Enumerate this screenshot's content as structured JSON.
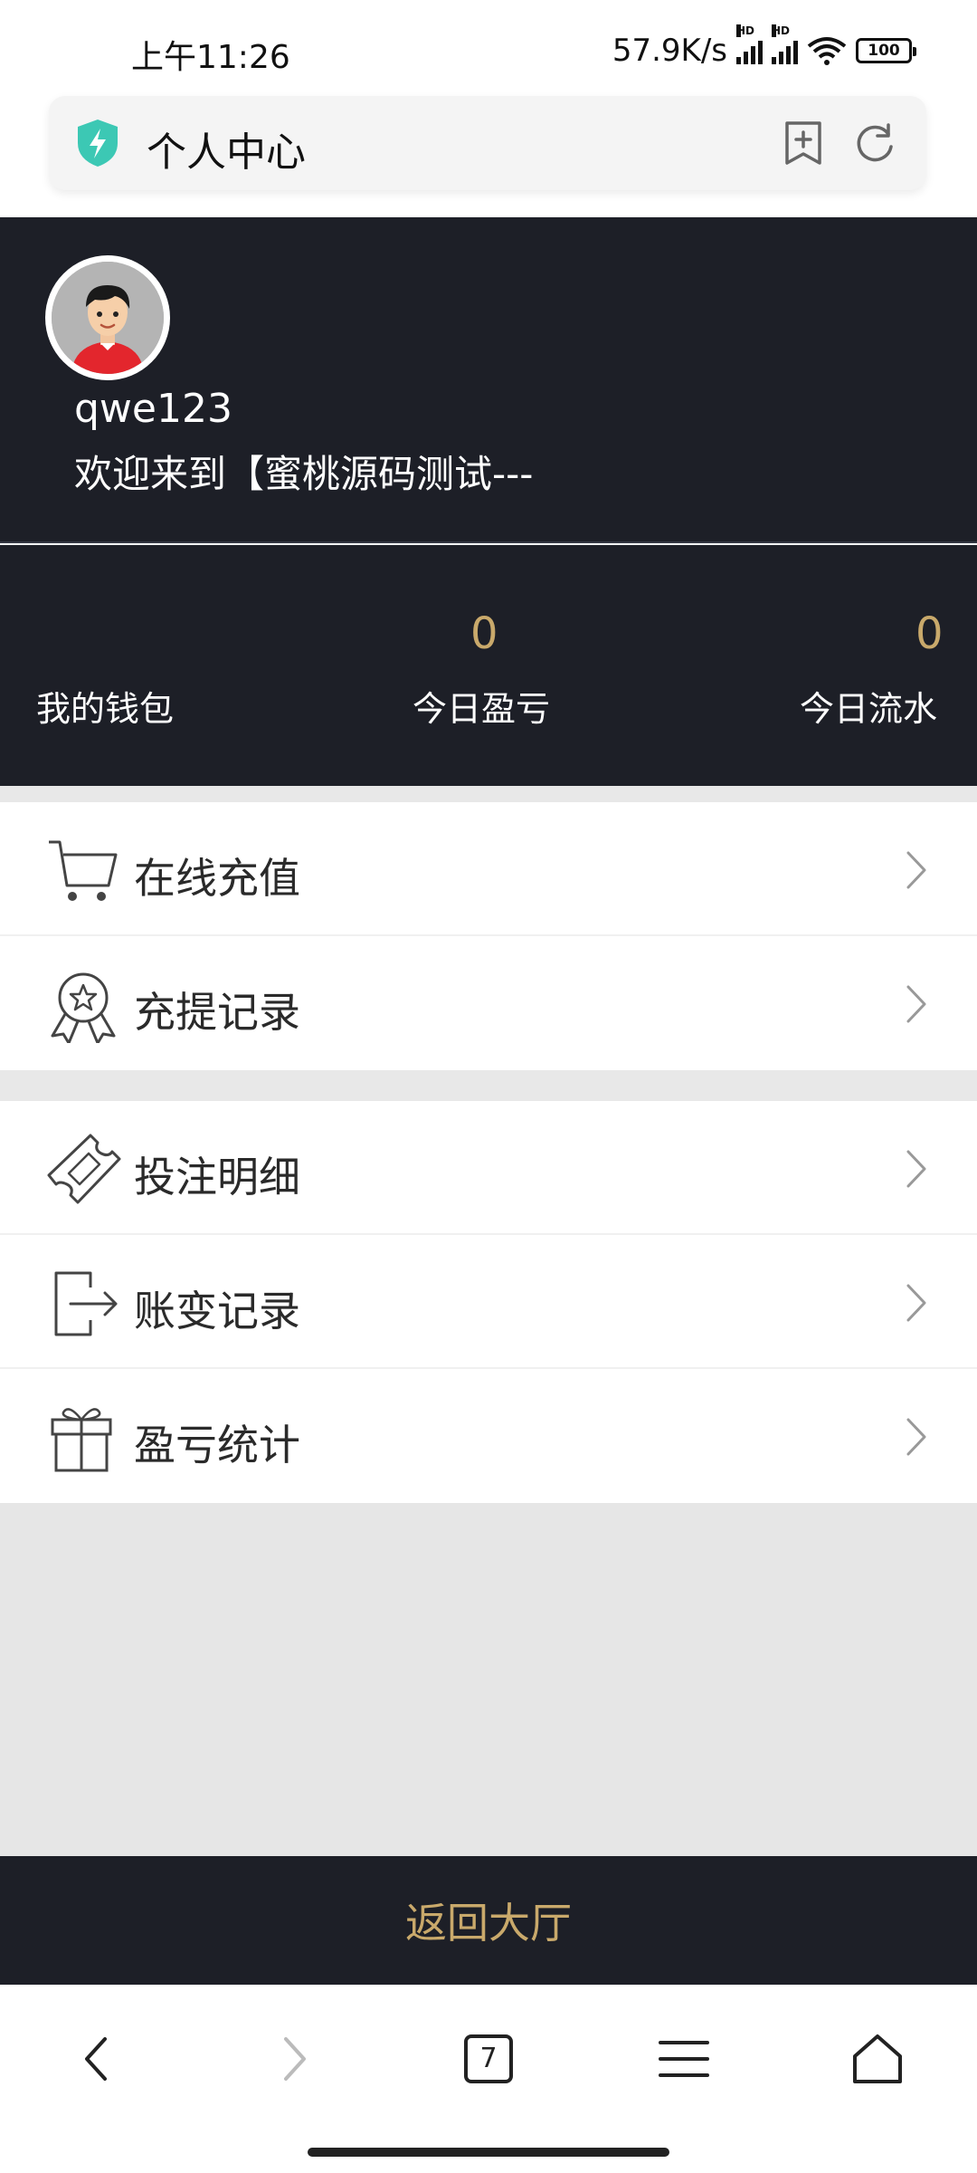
{
  "status_bar": {
    "time": "上午11:26",
    "net_speed": "57.9K/s",
    "signal_badge": "HD",
    "battery": "100"
  },
  "address_bar": {
    "title": "个人中心",
    "shield_icon": "shield-bolt-icon",
    "bookmark_icon": "bookmark-add-icon",
    "refresh_icon": "refresh-icon"
  },
  "profile": {
    "username": "qwe123",
    "welcome": "欢迎来到【蜜桃源码测试---"
  },
  "stats": [
    {
      "label": "我的钱包",
      "value": ""
    },
    {
      "label": "今日盈亏",
      "value": "0"
    },
    {
      "label": "今日流水",
      "value": "0"
    }
  ],
  "menu_groups": [
    [
      {
        "label": "在线充值",
        "icon": "cart-icon"
      },
      {
        "label": "充提记录",
        "icon": "badge-star-icon"
      }
    ],
    [
      {
        "label": "投注明细",
        "icon": "ticket-icon"
      },
      {
        "label": "账变记录",
        "icon": "exit-arrow-icon"
      },
      {
        "label": "盈亏统计",
        "icon": "gift-icon"
      }
    ]
  ],
  "return_button": {
    "label": "返回大厅"
  },
  "browser_nav": {
    "tabs_count": "7"
  },
  "colors": {
    "dark_bg": "#1d1f27",
    "gold": "#c9a96b",
    "shield": "#3cc8b4"
  }
}
